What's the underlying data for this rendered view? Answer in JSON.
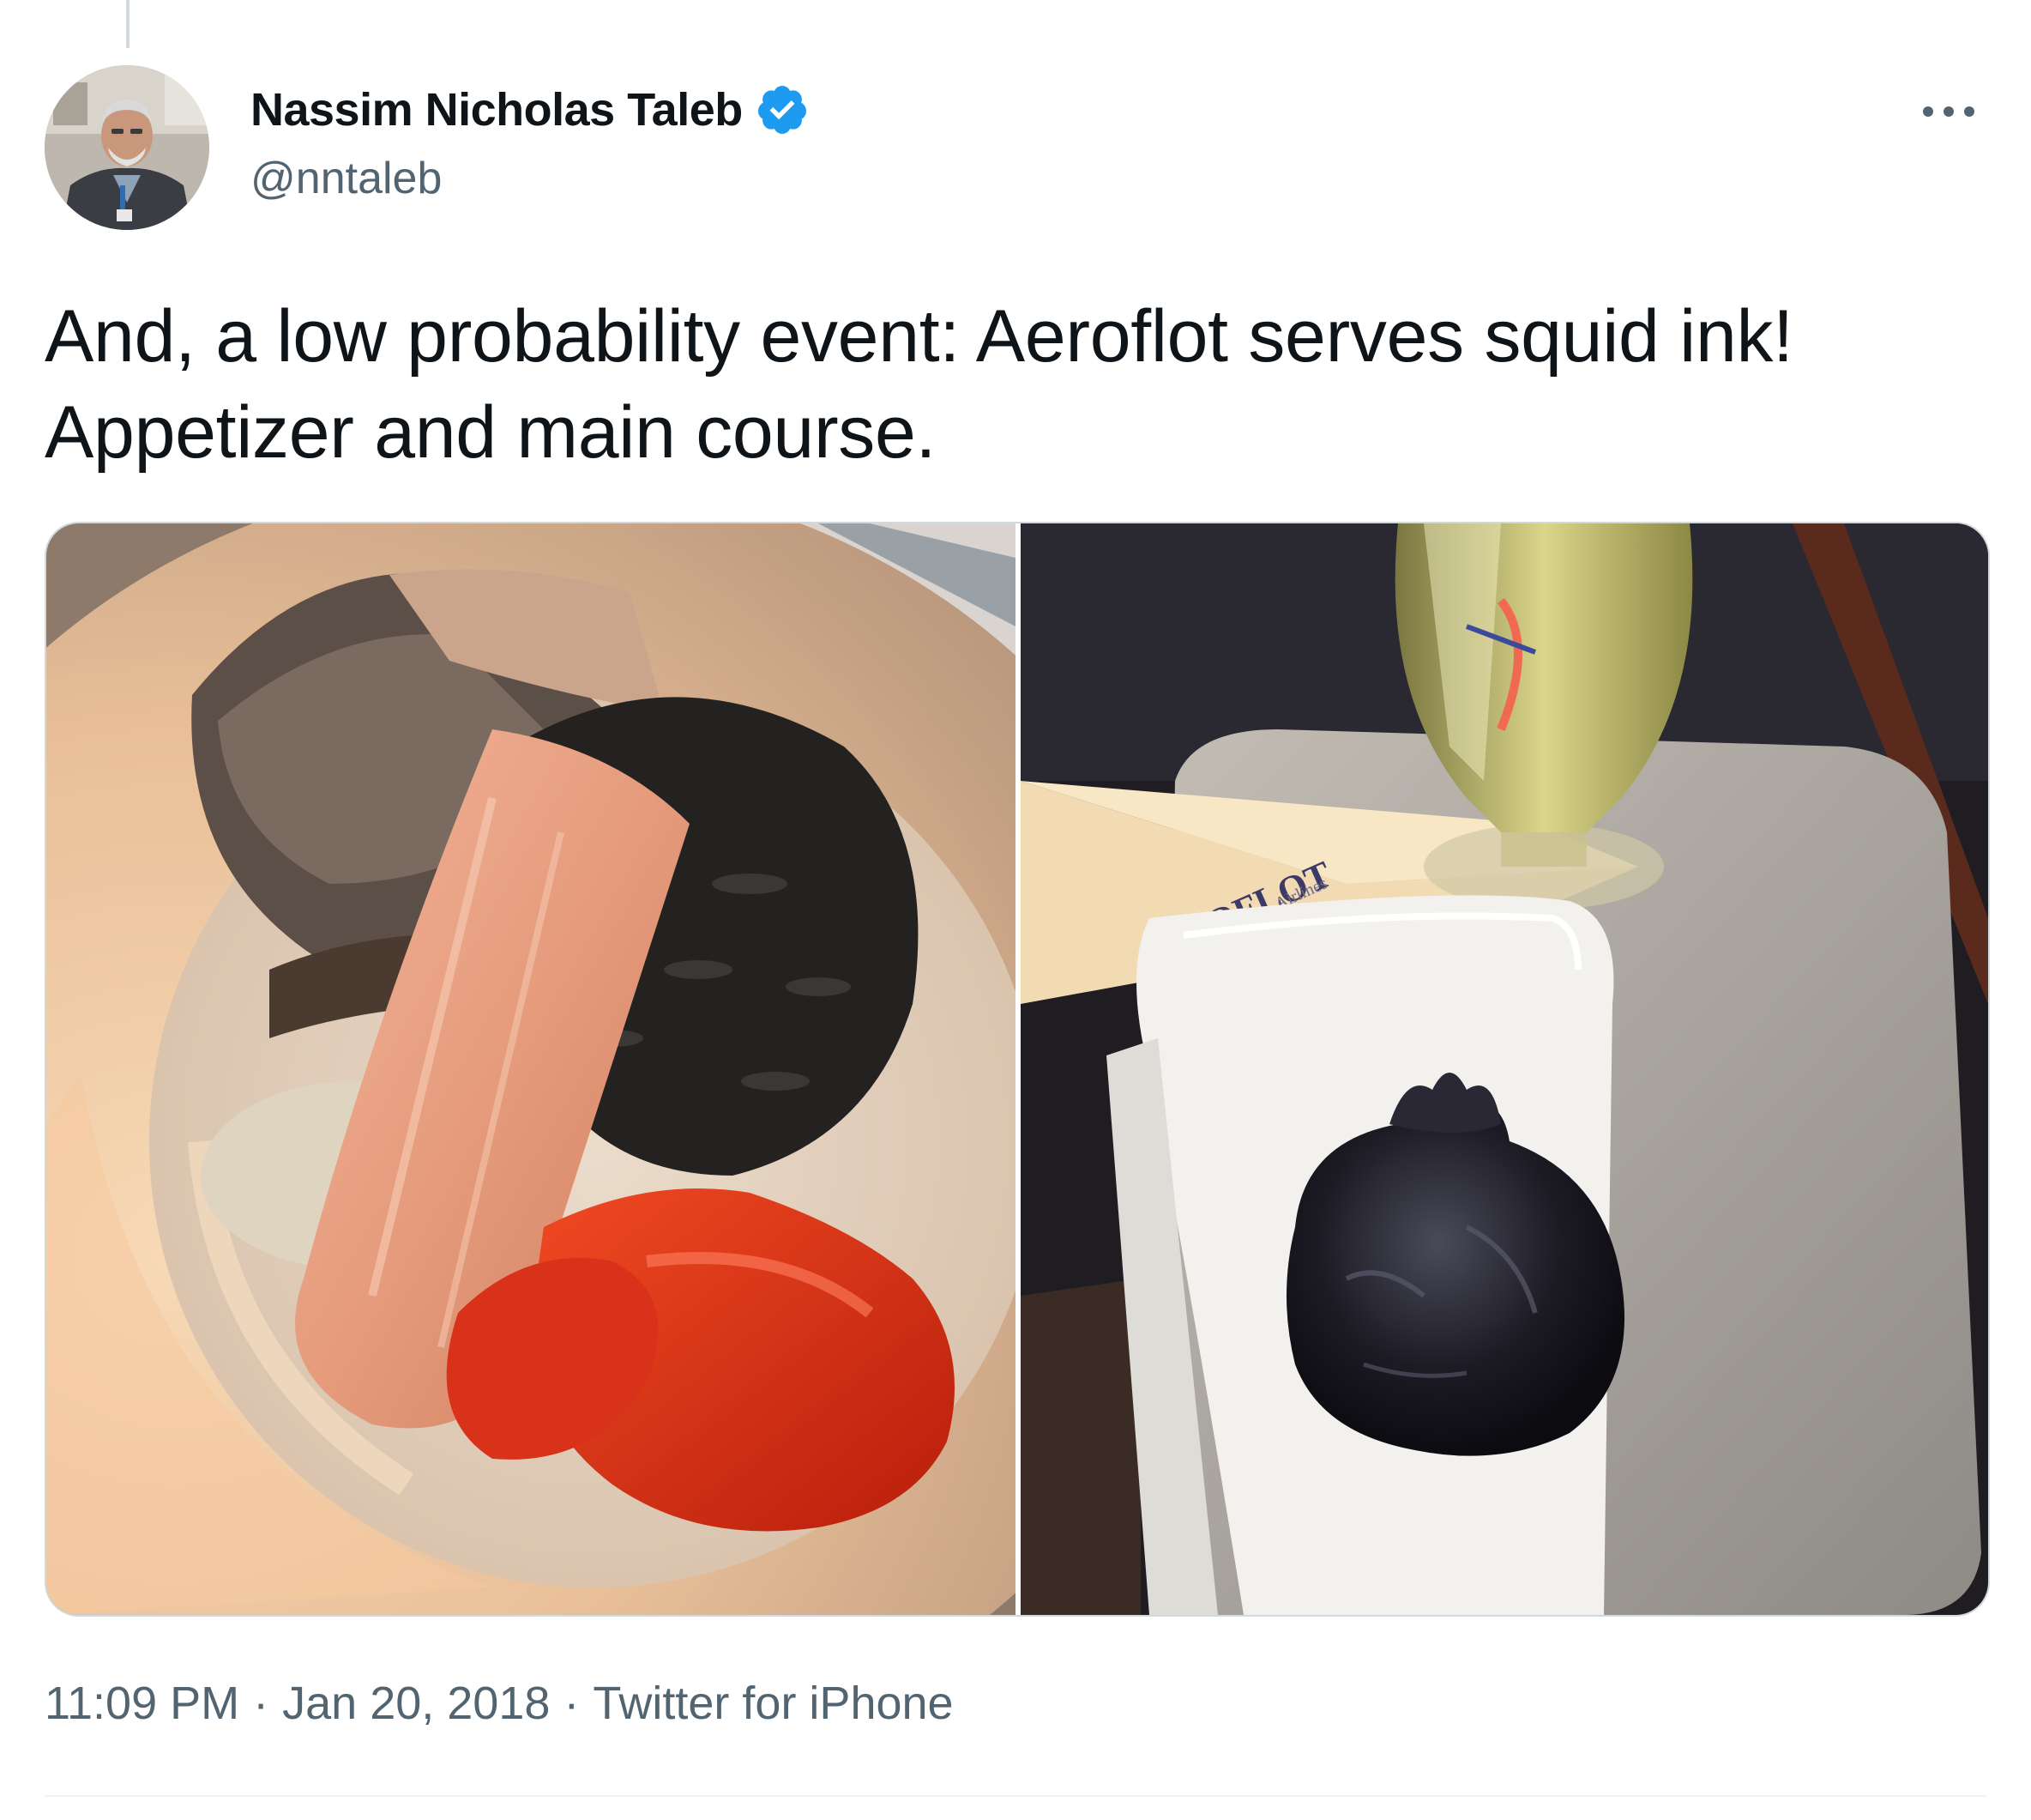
{
  "tweet": {
    "author": {
      "display_name": "Nassim Nicholas Taleb",
      "handle": "@nntaleb",
      "verified": true
    },
    "text_line1": "And, a low probability event: Aeroflot serves squid ink!",
    "text_line2": "Appetizer and main course.",
    "timestamp_time": "11:09 PM",
    "timestamp_date": "Jan 20, 2018",
    "source": "Twitter for iPhone",
    "separator": "·",
    "media": [
      {
        "name": "photo-salmon-squid-ink-rice",
        "alt": ""
      },
      {
        "name": "photo-squid-ink-dumpling",
        "alt": ""
      }
    ],
    "napkin_text": "AEROFLOT",
    "napkin_subtext": "Airlines"
  },
  "colors": {
    "primary_text": "#0f1419",
    "secondary_text": "#536471",
    "verified_blue": "#1d9bf0",
    "border": "#cfd9de"
  },
  "icons": {
    "verified": "verified-badge-icon",
    "more": "more-horizontal-icon"
  }
}
